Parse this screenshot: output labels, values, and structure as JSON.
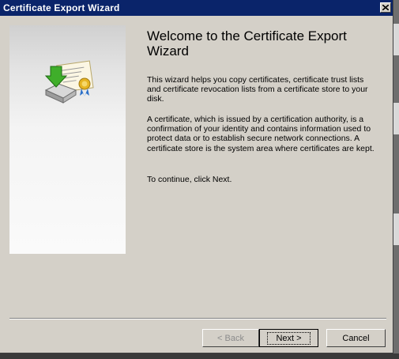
{
  "window": {
    "title": "Certificate Export Wizard",
    "close_label": "close"
  },
  "content": {
    "heading": "Welcome to the Certificate Export Wizard",
    "paragraph1": "This wizard helps you copy certificates, certificate trust lists and certificate revocation lists from a certificate store to your disk.",
    "paragraph2": "A certificate, which is issued by a certification authority, is a confirmation of your identity and contains information used to protect data or to establish secure network connections. A certificate store is the system area where certificates are kept.",
    "paragraph3": "To continue, click Next."
  },
  "buttons": {
    "back": "< Back",
    "next": "Next >",
    "cancel": "Cancel"
  },
  "icons": {
    "close": "close-icon",
    "wizard": "certificate-export-icon"
  },
  "colors": {
    "titlebar": "#0a246a",
    "window": "#d4d0c8",
    "disabled_text": "#8c8c8c"
  }
}
